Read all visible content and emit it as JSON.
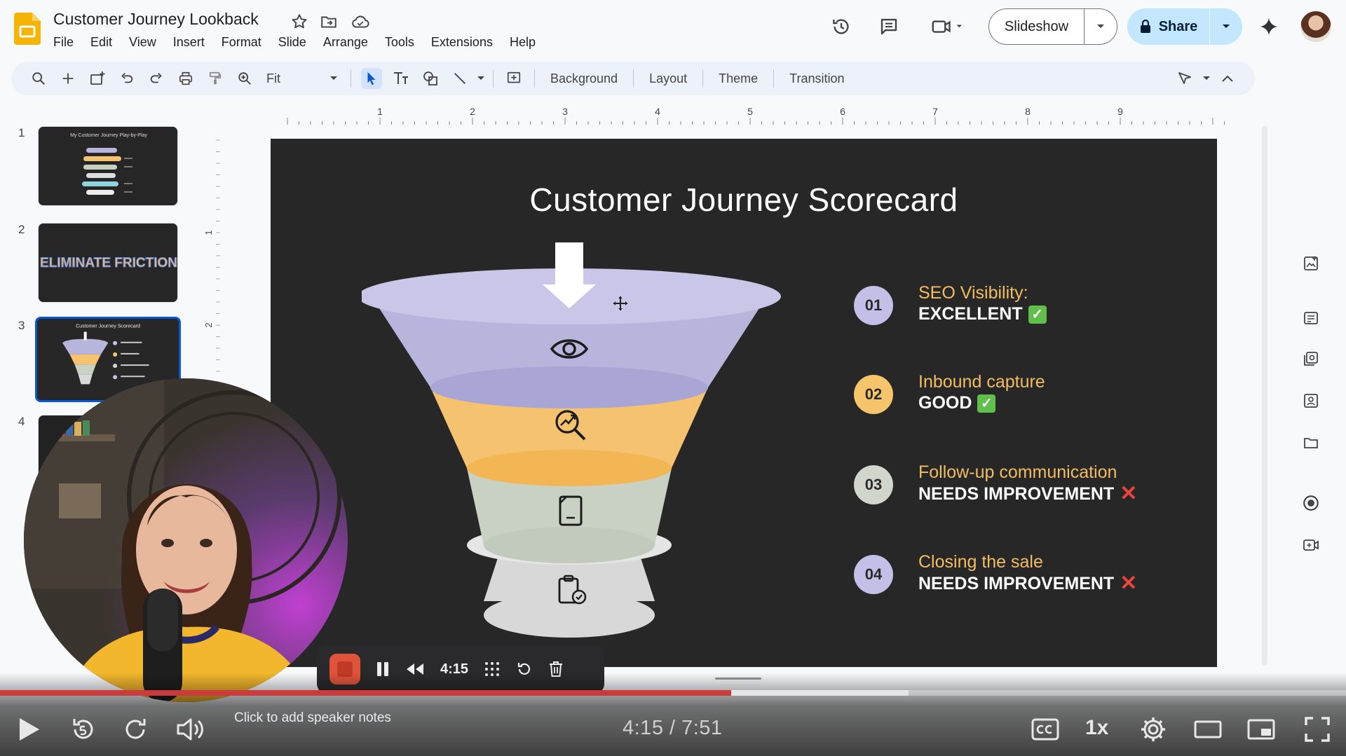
{
  "app": {
    "doc_title": "Customer Journey Lookback",
    "menu": [
      "File",
      "Edit",
      "View",
      "Insert",
      "Format",
      "Slide",
      "Arrange",
      "Tools",
      "Extensions",
      "Help"
    ],
    "slideshow_label": "Slideshow",
    "share_label": "Share"
  },
  "toolbar": {
    "zoom": "Fit",
    "background_label": "Background",
    "layout_label": "Layout",
    "theme_label": "Theme",
    "transition_label": "Transition"
  },
  "ruler": {
    "h_ticks": [
      "1",
      "2",
      "3",
      "4",
      "5",
      "6",
      "7",
      "8",
      "9"
    ],
    "v_ticks": [
      "1",
      "2"
    ]
  },
  "filmstrip": {
    "slides": [
      {
        "num": "1",
        "title": "My Customer Journey Play-by-Play"
      },
      {
        "num": "2",
        "title": "ELIMINATE FRICTION"
      },
      {
        "num": "3",
        "title": "Customer Journey Scorecard",
        "selected": true
      },
      {
        "num": "4",
        "title": ""
      }
    ]
  },
  "slide": {
    "title": "Customer Journey Scorecard",
    "funnel_icons": [
      "eye-icon",
      "search-growth-icon",
      "mobile-document-icon",
      "clipboard-check-icon"
    ],
    "colors": {
      "background": "#282727",
      "layer1": "#b8b5dd",
      "layer2": "#f5c270",
      "layer3": "#c9d1c3",
      "layer4": "#d8d8d8",
      "label": "#f2bd60",
      "ok": "#5fbf4a",
      "bad": "#e8453c"
    },
    "items": [
      {
        "num": "01",
        "label": "SEO Visibility:",
        "status": "EXCELLENT",
        "mark": "check",
        "color": "#c3bfe6"
      },
      {
        "num": "02",
        "label": "Inbound capture",
        "status": "GOOD",
        "mark": "check",
        "color": "#f6c56b"
      },
      {
        "num": "03",
        "label": "Follow-up communication",
        "status": "NEEDS IMPROVEMENT",
        "mark": "cross",
        "color": "#d0d6cc"
      },
      {
        "num": "04",
        "label": "Closing the sale",
        "status": "NEEDS IMPROVEMENT",
        "mark": "cross",
        "color": "#c3bfe6"
      }
    ]
  },
  "recorder": {
    "time": "4:15"
  },
  "player": {
    "speaker_notes_placeholder": "Click to add speaker notes",
    "time": "4:15 / 7:51",
    "speed": "1x",
    "progress": 0.543,
    "buffered": 0.675
  }
}
